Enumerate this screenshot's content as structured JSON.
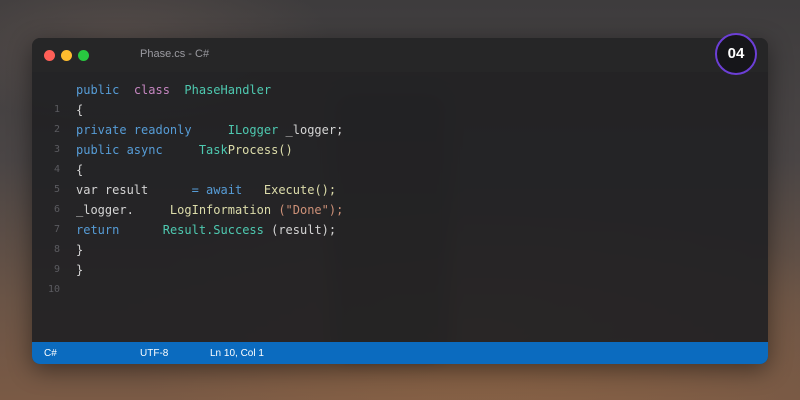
{
  "window": {
    "title": "Phase.cs - C#"
  },
  "badge": {
    "text": "04",
    "ring_color": "#6c3fd6"
  },
  "code_lines": [
    {
      "num": "1",
      "tokens": [
        "public",
        "class",
        "PhaseHandler"
      ]
    },
    {
      "num": "2",
      "tokens": [
        "{"
      ]
    },
    {
      "num": "3",
      "tokens": [
        "private readonly",
        "ILogger",
        "_logger;"
      ]
    },
    {
      "num": "4",
      "tokens": [
        "public async",
        "Task",
        "Process()"
      ]
    },
    {
      "num": "5",
      "tokens": [
        "{"
      ]
    },
    {
      "num": "6",
      "tokens": [
        "var result",
        "= await",
        "Execute();"
      ]
    },
    {
      "num": "7",
      "tokens": [
        "_logger.",
        "LogInformation",
        "(\"Done\");"
      ]
    },
    {
      "num": "8",
      "tokens": [
        "return",
        "Result.Success",
        "(result);"
      ]
    },
    {
      "num": "9",
      "tokens": [
        "}"
      ]
    },
    {
      "num": "10",
      "tokens": [
        "}"
      ]
    }
  ],
  "statusbar": {
    "language": "C#",
    "encoding": "UTF-8",
    "position": "Ln 10, Col 1",
    "color": "#0b6bbf"
  }
}
